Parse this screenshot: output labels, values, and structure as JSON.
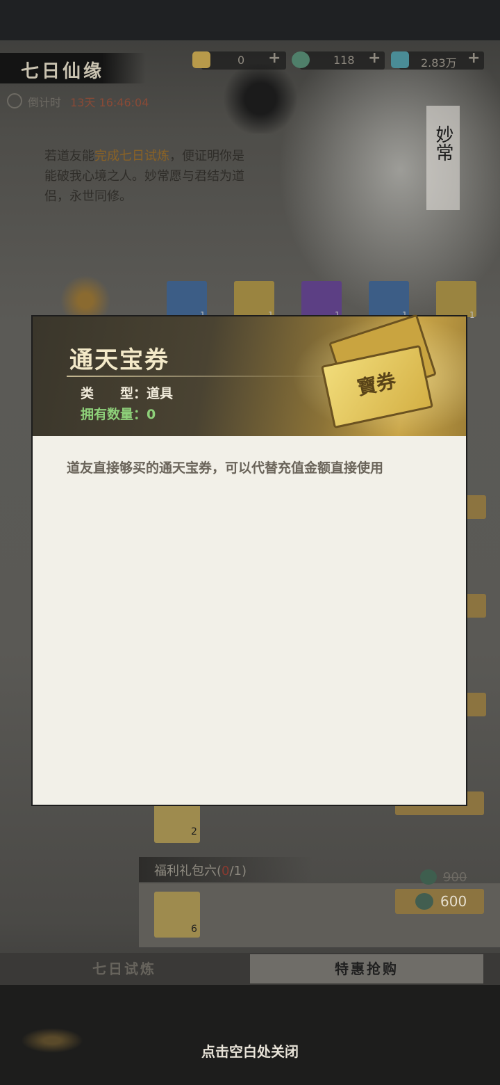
{
  "header": {
    "title": "七日仙缘",
    "countdown_label": "倒计时",
    "countdown_time": "13天 16:46:04"
  },
  "resources": [
    {
      "icon": "ticket-icon",
      "value": "0",
      "color": "#b89a4a"
    },
    {
      "icon": "jade-coin-icon",
      "value": "118",
      "color": "#4f7f6a"
    },
    {
      "icon": "spirit-stone-icon",
      "value": "2.83万",
      "color": "#4a8c96"
    }
  ],
  "story": {
    "part1": "若道友能",
    "highlight": "完成七日试炼",
    "part2": "，便证明你是能破我心境之人。妙常愿与君结为道侣，永世同修。"
  },
  "npc_name": "妙常",
  "reward_slots": [
    {
      "icon": "incense-burner-icon",
      "count": "1"
    },
    {
      "icon": "incense-burner-icon",
      "count": "1"
    },
    {
      "icon": "purple-item-icon",
      "count": "1"
    },
    {
      "icon": "blue-item-icon",
      "count": "1"
    },
    {
      "icon": "jade-coin-icon",
      "count": "1"
    }
  ],
  "modal": {
    "item_name": "通天宝券",
    "type_label": "类　　型：",
    "type_value": "道具",
    "own_label": "拥有数量：",
    "own_value": "0",
    "ticket_glyph": "寶券",
    "description": "道友直接够买的通天宝券，可以代替充值金额直接使用"
  },
  "list": {
    "pack5_count": "2",
    "pack6_title_prefix": "福利礼包六(",
    "pack6_progress": "0",
    "pack6_title_suffix": "/1)",
    "pack6_count": "6",
    "old_price": "900",
    "new_price": "600"
  },
  "tabs": {
    "tab1": "七日试炼",
    "tab2": "特惠抢购"
  },
  "close_hint": "点击空白处关闭"
}
